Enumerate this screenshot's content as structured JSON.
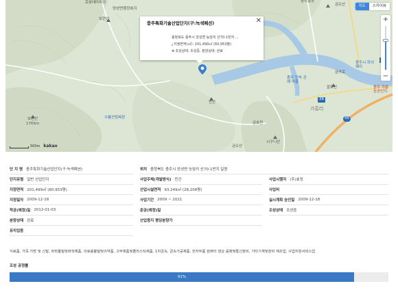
{
  "map": {
    "type_toggle": {
      "map_label": "지도",
      "skyview_label": "스카이뷰",
      "active": "지도"
    },
    "zoom": {
      "in_label": "+",
      "out_label": "−",
      "level_fraction": 0.67
    },
    "scale": {
      "text": "500m"
    },
    "logo": "kakao",
    "labels": {
      "l1": "로봇테마파크",
      "l2": "양성면행정복지",
      "l3": "보련산",
      "l4": "금오산",
      "l5": "보련산",
      "l6": "1765m",
      "l7": "수룡산림욕장",
      "l8": "안산",
      "l9": "충주 민속 공예 마을",
      "l10": "알토산",
      "l11": "충주시 하이웨이",
      "l12": "금곡로",
      "l13": "금호천",
      "l14": "가흥리",
      "l15": "충주 가흥 농공단지",
      "l16": "시구니산",
      "l17": "충주흥농",
      "l18": "금오산"
    },
    "road_badges": {
      "b1": "38",
      "b2": "38",
      "b3": "45"
    },
    "popup": {
      "title": "충주특화기술산업단지(구:녹색폐션)",
      "close": "✕",
      "address": "충청북도 충주시 앙성면 능암리 산70-1번지 ...",
      "area": "지정면적(㎡): 201,499㎡ (60,953평)",
      "status": "조성상태: 조성중, 분양상태: 완료"
    }
  },
  "info": {
    "complex_name": {
      "label": "단 지 명",
      "value": "충주특화기술산업단지(구:녹색폐션)"
    },
    "location": {
      "label": "위치",
      "value": "충청북도 충주시 앙성면 능암리 산70-1번지 일원"
    },
    "complex_type": {
      "label": "단지유형",
      "value": "일반 산업단지"
    },
    "operator_type": {
      "label": "사업주체(개발방식)",
      "value": "민간"
    },
    "developer": {
      "label": "사업시행자",
      "value": "(주)효정"
    },
    "designated_area": {
      "label": "지정면적",
      "value": "201,499㎡ (60,953평)"
    },
    "industrial_area": {
      "label": "산업시설면적",
      "value": "93,249㎡ (28,208평)"
    },
    "project_cost": {
      "label": "사업비",
      "value": ""
    },
    "designated_date": {
      "label": "지정일자",
      "value": "2009-12-18"
    },
    "project_period": {
      "label": "사업기간",
      "value": "2009 ~ 2021"
    },
    "plan_approval": {
      "label": "실시계획 승인일",
      "value": "2009-12-18"
    },
    "start_date": {
      "label": "착공(예정)일",
      "value": "2012-01-03"
    },
    "completion_date": {
      "label": "준공(예정)일",
      "value": ""
    },
    "build_status": {
      "label": "조성상태",
      "value": "조성중"
    },
    "sale_status": {
      "label": "분양상태",
      "value": "완료"
    },
    "tenant_status": {
      "label": "산업용지 평당분양가",
      "value": ""
    },
    "industries_title": "유치업종",
    "industries": "식료품, 가죽 가방 및 신발, 화학물질및화학제품, 의료용물질및의약품, 고무제품및플라스틱제품, 1차금속, 금속가공제품, 전자부품 컴퓨터 영상 음향및통신장비, 기타기계및장비 제조업, 사업지원서비스업",
    "progress_title": "조성 공정률",
    "progress_value": 91,
    "progress_label": "91%"
  },
  "colors": {
    "accent": "#3b86e0",
    "progress": "#3a79c4",
    "river": "#9fc3e4",
    "highway": "#f0a14a"
  }
}
